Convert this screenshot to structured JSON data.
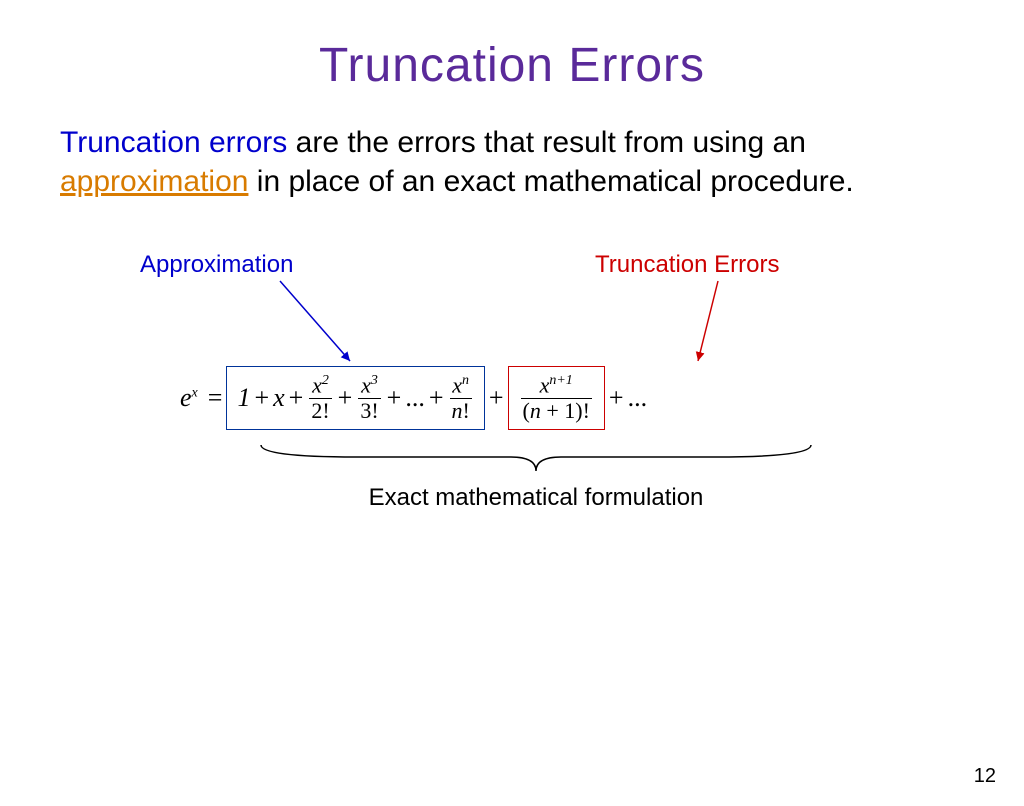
{
  "title": "Truncation Errors",
  "paragraph": {
    "term": "Truncation errors",
    "mid1": " are the errors that result from using an ",
    "approx": "approximation",
    "mid2": " in place of an exact mathematical procedure."
  },
  "labels": {
    "approximation": "Approximation",
    "truncation_errors": "Truncation Errors"
  },
  "equation": {
    "lhs_base": "e",
    "lhs_exp": "x",
    "eq": "=",
    "t1": "1",
    "plus": "+",
    "t2": "x",
    "f1_num_base": "x",
    "f1_num_exp": "2",
    "f1_den": "2!",
    "f2_num_base": "x",
    "f2_num_exp": "3",
    "f2_den": "3!",
    "dots": "...",
    "fn_num_base": "x",
    "fn_num_exp": "n",
    "fn_den_var": "n",
    "fn_den_bang": "!",
    "fr_num_base": "x",
    "fr_num_exp": "n+1",
    "fr_den_open": "(",
    "fr_den_var": "n",
    "fr_den_plus": " + 1)",
    "fr_den_bang": "!"
  },
  "brace_caption": "Exact mathematical formulation",
  "page_number": "12"
}
